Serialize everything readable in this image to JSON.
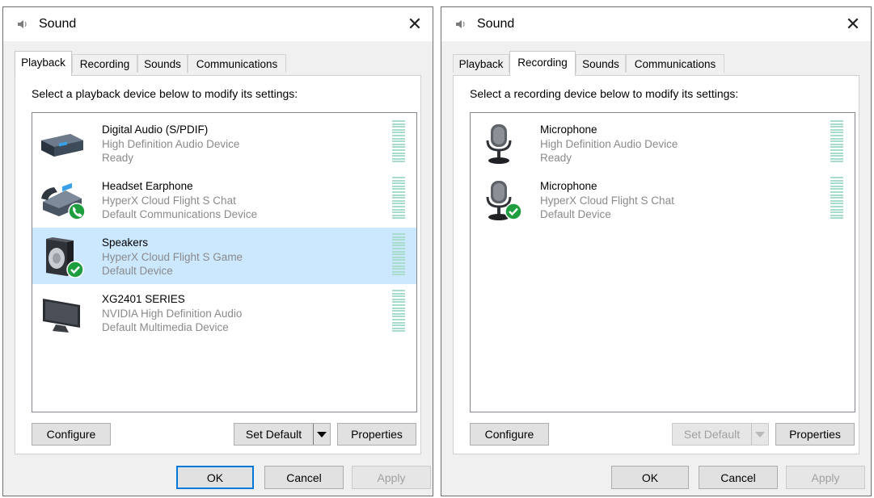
{
  "left_window": {
    "title": "Sound",
    "close_glyph": "✕",
    "tabs": [
      {
        "label": "Playback",
        "active": true
      },
      {
        "label": "Recording",
        "active": false
      },
      {
        "label": "Sounds",
        "active": false
      },
      {
        "label": "Communications",
        "active": false
      }
    ],
    "instruction": "Select a playback device below to modify its settings:",
    "devices": [
      {
        "name": "Digital Audio (S/PDIF)",
        "description": "High Definition Audio Device",
        "status": "Ready",
        "icon": "digital-audio-device-icon",
        "badge": null,
        "selected": false
      },
      {
        "name": "Headset Earphone",
        "description": "HyperX Cloud Flight S Chat",
        "status": "Default Communications Device",
        "icon": "telephone-icon",
        "badge": "phone",
        "selected": false
      },
      {
        "name": "Speakers",
        "description": "HyperX Cloud Flight S Game",
        "status": "Default Device",
        "icon": "speaker-icon",
        "badge": "check",
        "selected": true
      },
      {
        "name": "XG2401 SERIES",
        "description": "NVIDIA High Definition Audio",
        "status": "Default Multimedia Device",
        "icon": "monitor-icon",
        "badge": null,
        "selected": false
      }
    ],
    "buttons": {
      "configure": "Configure",
      "set_default": "Set Default",
      "properties": "Properties",
      "ok": "OK",
      "cancel": "Cancel",
      "apply": "Apply"
    }
  },
  "right_window": {
    "title": "Sound",
    "close_glyph": "✕",
    "tabs": [
      {
        "label": "Playback",
        "active": false
      },
      {
        "label": "Recording",
        "active": true
      },
      {
        "label": "Sounds",
        "active": false
      },
      {
        "label": "Communications",
        "active": false
      }
    ],
    "instruction": "Select a recording device below to modify its settings:",
    "devices": [
      {
        "name": "Microphone",
        "description": "High Definition Audio Device",
        "status": "Ready",
        "icon": "microphone-icon",
        "badge": null,
        "selected": false
      },
      {
        "name": "Microphone",
        "description": "HyperX Cloud Flight S Chat",
        "status": "Default Device",
        "icon": "microphone-icon",
        "badge": "check",
        "selected": false
      }
    ],
    "buttons": {
      "configure": "Configure",
      "set_default": "Set Default",
      "properties": "Properties",
      "ok": "OK",
      "cancel": "Cancel",
      "apply": "Apply"
    }
  },
  "colors": {
    "selection": "#cce8ff",
    "meter": "#a8dccd",
    "badge_green": "#1e9e3e",
    "focus_border": "#0078d7"
  }
}
